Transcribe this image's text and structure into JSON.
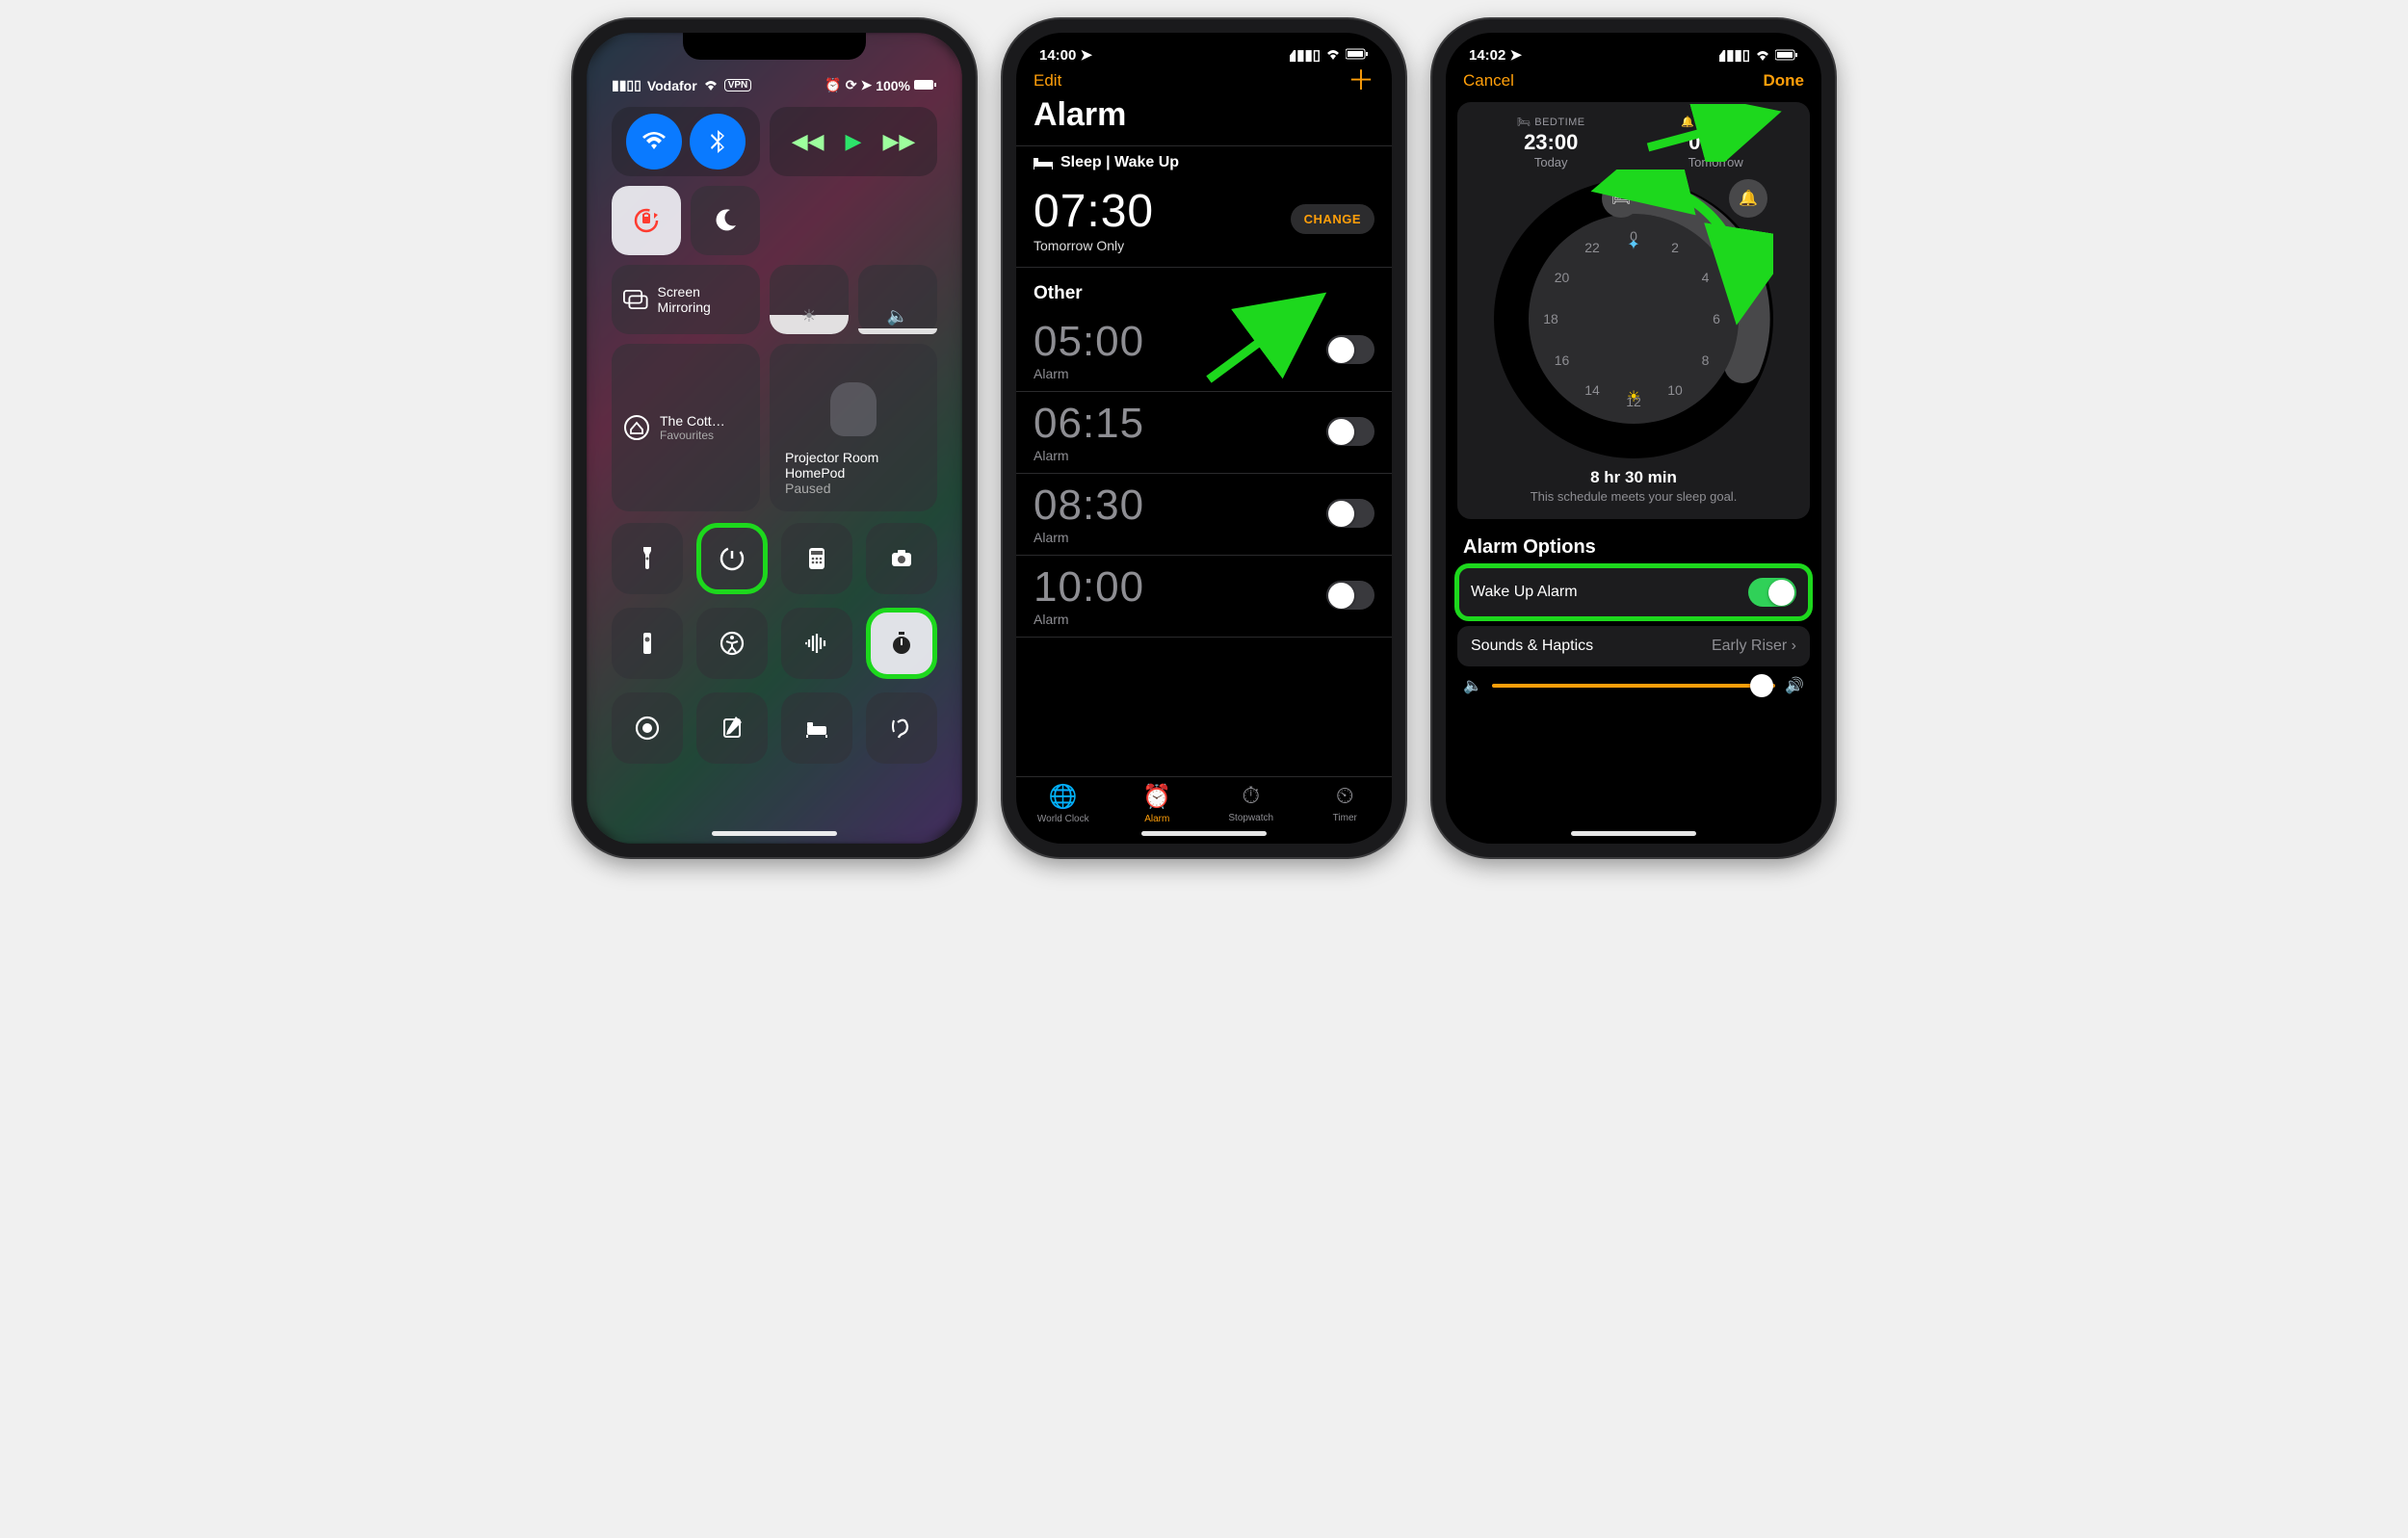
{
  "phone1": {
    "status": {
      "carrier": "Vodafor",
      "vpn": "VPN",
      "battery": "100%"
    },
    "mirror_label": "Screen Mirroring",
    "home": {
      "name": "The Cott…",
      "sub": "Favourites"
    },
    "homepod": {
      "line1": "Projector Room",
      "line2": "HomePod",
      "state": "Paused"
    },
    "icons": [
      "flashlight",
      "timer",
      "calculator",
      "camera",
      "remote",
      "accessibility",
      "voice-memo",
      "stopwatch",
      "screen-record",
      "notes",
      "sleep",
      "hearing"
    ]
  },
  "phone2": {
    "status_time": "14:00",
    "nav": {
      "edit": "Edit"
    },
    "title": "Alarm",
    "sleep_section": "Sleep | Wake Up",
    "wake": {
      "time": "07:30",
      "sub": "Tomorrow Only",
      "change": "CHANGE"
    },
    "other_label": "Other",
    "alarms": [
      {
        "time": "05:00",
        "label": "Alarm",
        "on": false
      },
      {
        "time": "06:15",
        "label": "Alarm",
        "on": false
      },
      {
        "time": "08:30",
        "label": "Alarm",
        "on": false
      },
      {
        "time": "10:00",
        "label": "Alarm",
        "on": false
      }
    ],
    "tabs": [
      "World Clock",
      "Alarm",
      "Stopwatch",
      "Timer"
    ]
  },
  "phone3": {
    "status_time": "14:02",
    "nav": {
      "cancel": "Cancel",
      "done": "Done"
    },
    "bed": {
      "label": "BEDTIME",
      "time": "23:00",
      "day": "Today"
    },
    "wake": {
      "label": "WAKE UP",
      "time": "07:30",
      "day": "Tomorrow"
    },
    "dial_numbers": [
      "0",
      "2",
      "4",
      "6",
      "8",
      "10",
      "12",
      "14",
      "16",
      "18",
      "20",
      "22"
    ],
    "goal": {
      "duration": "8 hr 30 min",
      "msg": "This schedule meets your sleep goal."
    },
    "options_header": "Alarm Options",
    "wake_alarm": {
      "label": "Wake Up Alarm",
      "on": true
    },
    "sounds": {
      "label": "Sounds & Haptics",
      "value": "Early Riser"
    }
  }
}
